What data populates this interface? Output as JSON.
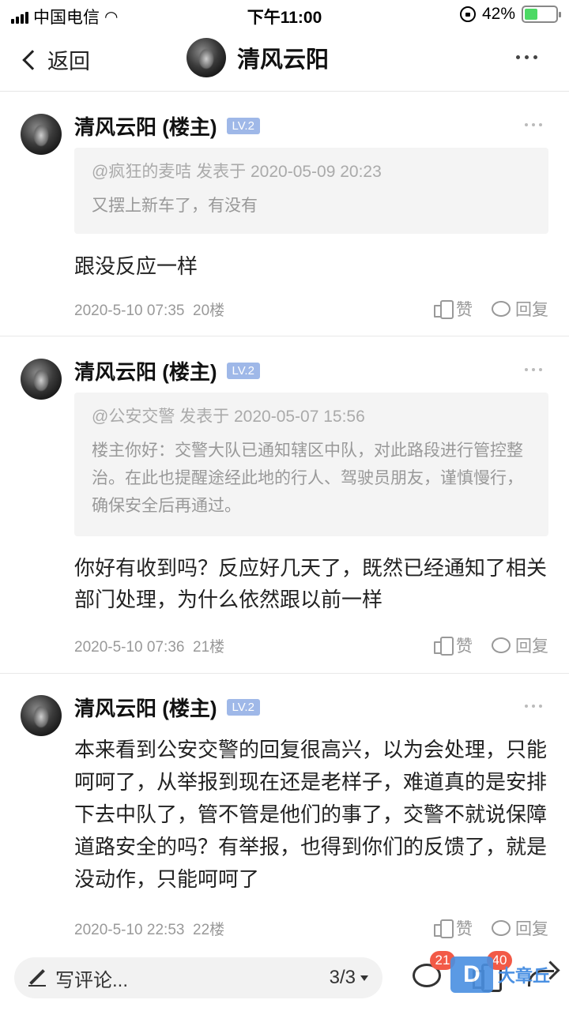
{
  "status_bar": {
    "carrier": "中国电信",
    "time": "下午11:00",
    "battery_percent": "42%",
    "battery_level": 0.42
  },
  "nav": {
    "back_label": "返回",
    "title": "清风云阳"
  },
  "posts": [
    {
      "author": "清风云阳 (楼主)",
      "level": "LV.2",
      "quote": {
        "meta": "@疯狂的麦咭 发表于 2020-05-09 20:23",
        "text": "又摆上新车了，有没有"
      },
      "body": "跟没反应一样",
      "time": "2020-5-10 07:35",
      "floor": "20楼",
      "like_label": "赞",
      "reply_label": "回复"
    },
    {
      "author": "清风云阳 (楼主)",
      "level": "LV.2",
      "quote": {
        "meta": "@公安交警 发表于 2020-05-07 15:56",
        "text": "楼主你好：交警大队已通知辖区中队，对此路段进行管控整治。在此也提醒途经此地的行人、驾驶员朋友，谨慎慢行，确保安全后再通过。"
      },
      "body": "你好有收到吗？反应好几天了，既然已经通知了相关部门处理，为什么依然跟以前一样",
      "time": "2020-5-10 07:36",
      "floor": "21楼",
      "like_label": "赞",
      "reply_label": "回复"
    },
    {
      "author": "清风云阳 (楼主)",
      "level": "LV.2",
      "body": "本来看到公安交警的回复很高兴，以为会处理，只能呵呵了，从举报到现在还是老样子，难道真的是安排下去中队了，管不管是他们的事了，交警不就说保障道路安全的吗？有举报，也得到你们的反馈了，就是没动作，只能呵呵了",
      "time": "2020-5-10 22:53",
      "floor": "22楼",
      "like_label": "赞",
      "reply_label": "回复"
    }
  ],
  "bottom_bar": {
    "comment_placeholder": "写评论...",
    "page_indicator": "3/3",
    "comment_count": "21",
    "like_count": "40"
  },
  "watermark": {
    "logo": "D",
    "text": "大章丘"
  },
  "colors": {
    "level_badge": "#9fb8e8",
    "count_badge": "#f25a47",
    "battery_fill": "#4cd964"
  }
}
